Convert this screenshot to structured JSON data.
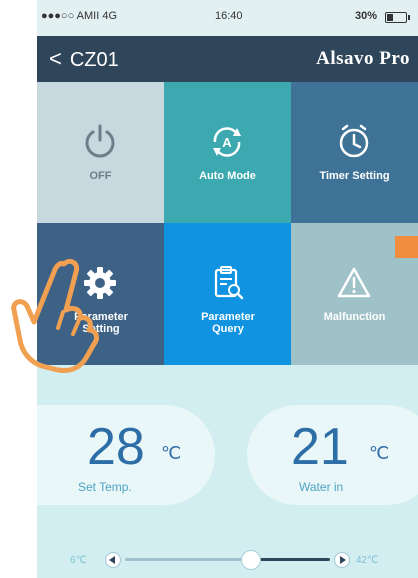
{
  "status_bar": {
    "carrier": "●●●○○ AMII 4G",
    "time": "16:40",
    "battery": "30%"
  },
  "header": {
    "back_label": "CZ01",
    "brand": "Alsavo Pro"
  },
  "tiles": [
    {
      "label": "OFF"
    },
    {
      "label": "Auto Mode"
    },
    {
      "label": "Timer Setting"
    },
    {
      "label": "Parameter Setting"
    },
    {
      "label": "Parameter Query"
    },
    {
      "label": "Malfunction"
    }
  ],
  "set_temp": {
    "value": "28",
    "unit": "℃",
    "label": "Set Temp."
  },
  "water_in": {
    "value": "21",
    "unit": "℃",
    "label": "Water in"
  },
  "slider": {
    "min_label": "6℃",
    "max_label": "42℃",
    "min": 6,
    "max": 42,
    "value": 28
  },
  "colors": {
    "header": "#2f4559",
    "accent_blue": "#2e6ea7",
    "query_tile": "#1093e0",
    "hand": "#f0a050"
  },
  "icons": [
    "power-icon",
    "auto-mode-icon",
    "clock-icon",
    "gear-icon",
    "clipboard-search-icon",
    "warning-icon",
    "hand-pointer-icon"
  ]
}
